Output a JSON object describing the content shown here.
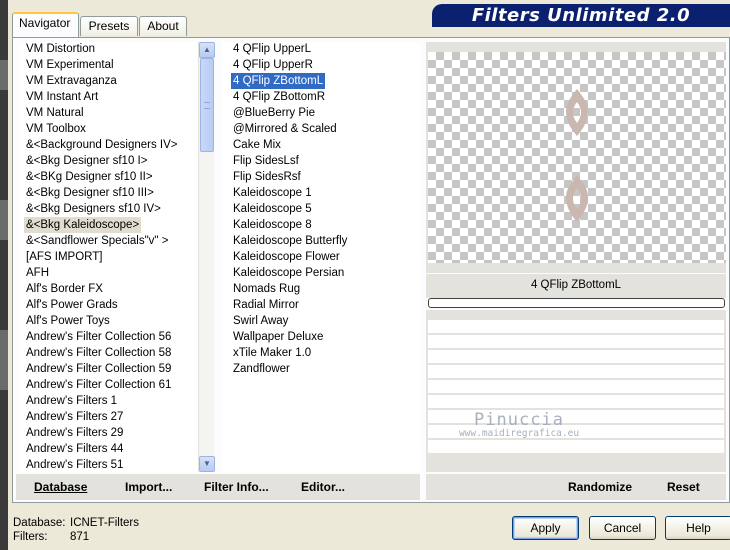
{
  "window": {
    "title": "Filters Unlimited 2.0",
    "tabs": [
      {
        "label": "Navigator",
        "active": true
      },
      {
        "label": "Presets",
        "active": false
      },
      {
        "label": "About",
        "active": false
      }
    ]
  },
  "categories": {
    "items": [
      "VM Distortion",
      "VM Experimental",
      "VM Extravaganza",
      "VM Instant Art",
      "VM Natural",
      "VM Toolbox",
      "&<Background Designers IV>",
      "&<Bkg Designer sf10 I>",
      "&<BKg Designer sf10 II>",
      "&<Bkg Designer sf10 III>",
      "&<Bkg Designers sf10 IV>",
      "&<Bkg Kaleidoscope>",
      "&<Sandflower Specials\"v\" >",
      "[AFS IMPORT]",
      "AFH",
      "Alf's Border FX",
      "Alf's Power Grads",
      "Alf's Power Toys",
      "Andrew's Filter Collection 56",
      "Andrew's Filter Collection 58",
      "Andrew's Filter Collection 59",
      "Andrew's Filter Collection 61",
      "Andrew's Filters 1",
      "Andrew's Filters 27",
      "Andrew's Filters 29",
      "Andrew's Filters 44",
      "Andrew's Filters 51"
    ],
    "selected": "&<Bkg Kaleidoscope>"
  },
  "filters": {
    "items": [
      "4 QFlip UpperL",
      "4 QFlip UpperR",
      "4 QFlip ZBottomL",
      "4 QFlip ZBottomR",
      "@BlueBerry Pie",
      "@Mirrored & Scaled",
      "Cake Mix",
      "Flip SidesLsf",
      "Flip SidesRsf",
      "Kaleidoscope 1",
      "Kaleidoscope 5",
      "Kaleidoscope 8",
      "Kaleidoscope Butterfly",
      "Kaleidoscope Flower",
      "Kaleidoscope Persian",
      "Nomads Rug",
      "Radial Mirror",
      "Swirl Away",
      "Wallpaper Deluxe",
      "xTile Maker 1.0",
      "Zandflower"
    ],
    "selected": "4 QFlip ZBottomL"
  },
  "preview": {
    "filter_name": "4 QFlip ZBottomL",
    "progress_fraction": 0,
    "shape_color": "#c9b7b0",
    "watermark_name": "Pinuccia",
    "watermark_url": "www.maidiregrafica.eu"
  },
  "actions": {
    "database": "Database",
    "import": "Import...",
    "filter_info": "Filter Info...",
    "editor": "Editor...",
    "randomize": "Randomize",
    "reset": "Reset"
  },
  "status": {
    "database_label": "Database:",
    "database_value": "ICNET-Filters",
    "filters_label": "Filters:",
    "filters_value": "871"
  },
  "dialog": {
    "apply": "Apply",
    "cancel": "Cancel",
    "help": "Help"
  },
  "colors": {
    "selection": "#316ac5",
    "banner": "#0c2070",
    "panel": "#e3e2dc"
  }
}
